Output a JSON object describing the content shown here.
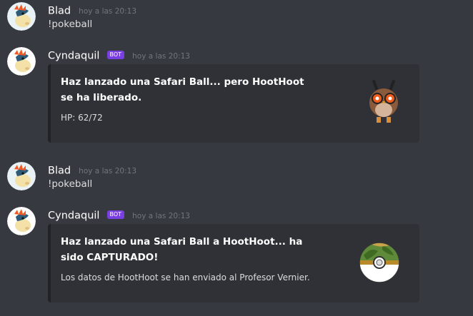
{
  "messages": [
    {
      "author": "Blad",
      "timestamp": "hoy a las 20:13",
      "text": "!pokeball",
      "avatar": "cyndaquil-avatar"
    },
    {
      "author": "Cyndaquil",
      "bot_tag": "BOT",
      "timestamp": "hoy a las 20:13",
      "avatar": "cyndaquil-avatar",
      "embed": {
        "title": "Haz lanzado una Safari Ball... pero HootHoot se ha liberado.",
        "description": "HP: 62/72",
        "thumbnail": "hoothoot-sprite"
      }
    },
    {
      "author": "Blad",
      "timestamp": "hoy a las 20:13",
      "text": "!pokeball",
      "avatar": "cyndaquil-avatar"
    },
    {
      "author": "Cyndaquil",
      "bot_tag": "BOT",
      "timestamp": "hoy a las 20:13",
      "avatar": "cyndaquil-avatar",
      "embed": {
        "title": "Haz lanzado una Safari Ball a HootHoot... ha sido CAPTURADO!",
        "description": "Los datos de HootHoot se han enviado al Profesor Vernier.",
        "thumbnail": "safari-ball-icon"
      }
    }
  ],
  "colors": {
    "background": "#36393f",
    "embed_bg": "#2f3136",
    "bot_badge": "#7a3fe0"
  }
}
